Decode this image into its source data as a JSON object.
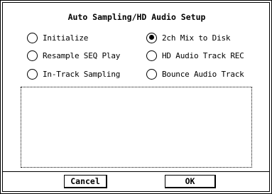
{
  "dialog": {
    "title": "Auto Sampling/HD Audio Setup"
  },
  "options": [
    {
      "label": "Initialize",
      "selected": false
    },
    {
      "label": "Resample SEQ Play",
      "selected": false
    },
    {
      "label": "In-Track Sampling",
      "selected": false
    },
    {
      "label": "2ch Mix to Disk",
      "selected": true
    },
    {
      "label": "HD Audio Track REC",
      "selected": false
    },
    {
      "label": "Bounce Audio Track",
      "selected": false
    }
  ],
  "buttons": {
    "cancel_label": "Cancel",
    "ok_label": "OK"
  }
}
